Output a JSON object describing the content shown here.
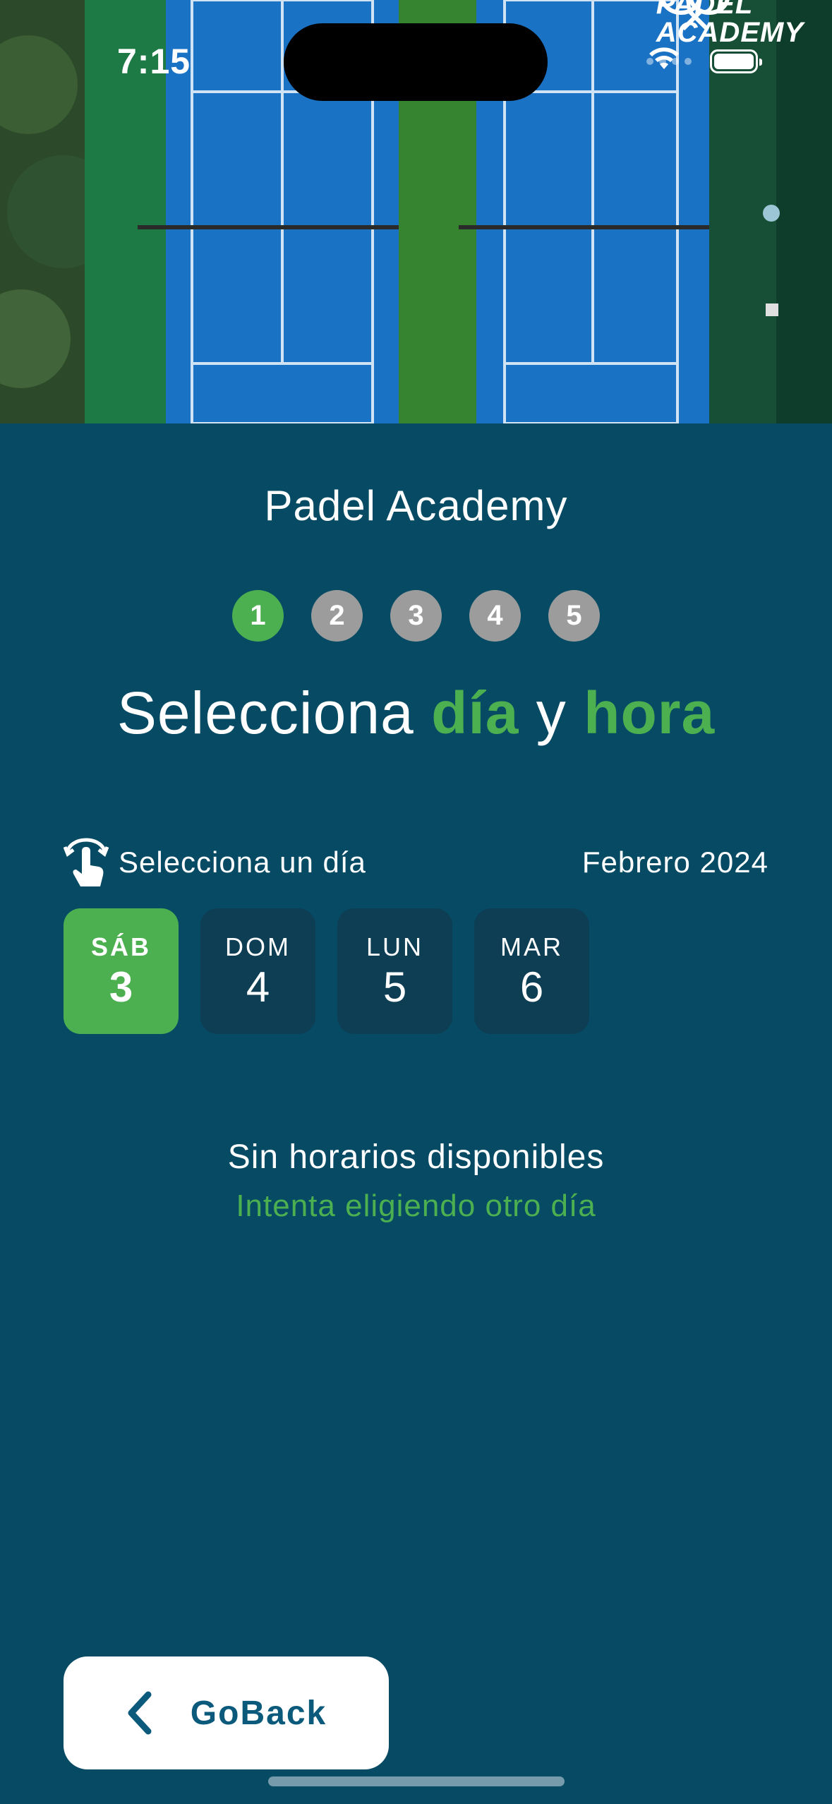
{
  "status_bar": {
    "time": "7:15"
  },
  "hero": {
    "logo_line1": "PADEL",
    "logo_line2": "ACADEMY",
    "logo_icon": "crossed-rackets-icon"
  },
  "app_title": "Padel Academy",
  "steps": [
    "1",
    "2",
    "3",
    "4",
    "5"
  ],
  "active_step": 1,
  "headline": {
    "part1": "Selecciona ",
    "accent1": "día",
    "part2": " y ",
    "accent2": "hora"
  },
  "day_picker": {
    "label": "Selecciona un día",
    "label_icon": "tap-hand-icon",
    "month": "Febrero 2024",
    "days": [
      {
        "name": "SÁB",
        "number": "3",
        "selected": true
      },
      {
        "name": "DOM",
        "number": "4",
        "selected": false
      },
      {
        "name": "LUN",
        "number": "5",
        "selected": false
      },
      {
        "name": "MAR",
        "number": "6",
        "selected": false
      }
    ]
  },
  "empty_state": {
    "title": "Sin horarios disponibles",
    "subtitle": "Intenta eligiendo otro día"
  },
  "back_button": {
    "label": "GoBack",
    "icon": "chevron-left-icon"
  },
  "colors": {
    "background": "#064a64",
    "accent": "#4caf50",
    "card": "#0d3e54",
    "button_text": "#0b5a7c"
  }
}
